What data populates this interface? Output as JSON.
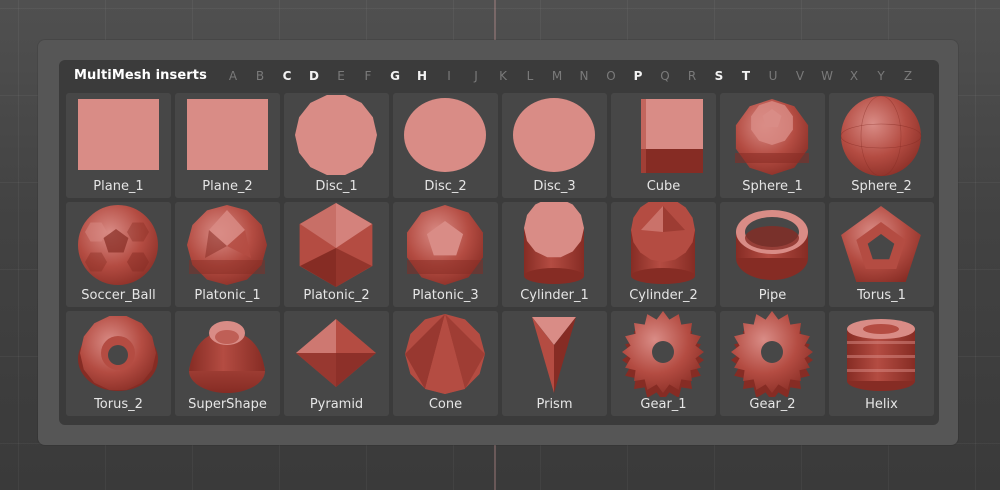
{
  "panel": {
    "title": "MultiMesh inserts",
    "letters": [
      {
        "char": "A",
        "active": false
      },
      {
        "char": "B",
        "active": false
      },
      {
        "char": "C",
        "active": true
      },
      {
        "char": "D",
        "active": true
      },
      {
        "char": "E",
        "active": false
      },
      {
        "char": "F",
        "active": false
      },
      {
        "char": "G",
        "active": true
      },
      {
        "char": "H",
        "active": true
      },
      {
        "char": "I",
        "active": false
      },
      {
        "char": "J",
        "active": false
      },
      {
        "char": "K",
        "active": false
      },
      {
        "char": "L",
        "active": false
      },
      {
        "char": "M",
        "active": false
      },
      {
        "char": "N",
        "active": false
      },
      {
        "char": "O",
        "active": false
      },
      {
        "char": "P",
        "active": true
      },
      {
        "char": "Q",
        "active": false
      },
      {
        "char": "R",
        "active": false
      },
      {
        "char": "S",
        "active": true
      },
      {
        "char": "T",
        "active": true
      },
      {
        "char": "U",
        "active": false
      },
      {
        "char": "V",
        "active": false
      },
      {
        "char": "W",
        "active": false
      },
      {
        "char": "X",
        "active": false
      },
      {
        "char": "Y",
        "active": false
      },
      {
        "char": "Z",
        "active": false
      }
    ]
  },
  "colors": {
    "background": "#474747",
    "panel": "#565656",
    "inner": "#3b3b3b",
    "tile": "#474747",
    "mesh_light": "#d98c86",
    "mesh_mid": "#b44c42",
    "mesh_dark": "#862c24"
  },
  "inserts": [
    {
      "label": "Plane_1",
      "icon": "plane-icon"
    },
    {
      "label": "Plane_2",
      "icon": "plane-icon"
    },
    {
      "label": "Disc_1",
      "icon": "disc-polygon-icon"
    },
    {
      "label": "Disc_2",
      "icon": "disc-icon"
    },
    {
      "label": "Disc_3",
      "icon": "disc-icon"
    },
    {
      "label": "Cube",
      "icon": "cube-icon"
    },
    {
      "label": "Sphere_1",
      "icon": "low-poly-sphere-icon"
    },
    {
      "label": "Sphere_2",
      "icon": "sphere-icon"
    },
    {
      "label": "Soccer_Ball",
      "icon": "soccer-ball-icon"
    },
    {
      "label": "Platonic_1",
      "icon": "platonic-icon"
    },
    {
      "label": "Platonic_2",
      "icon": "icosahedron-icon"
    },
    {
      "label": "Platonic_3",
      "icon": "dodecahedron-icon"
    },
    {
      "label": "Cylinder_1",
      "icon": "cylinder-icon"
    },
    {
      "label": "Cylinder_2",
      "icon": "faceted-cylinder-icon"
    },
    {
      "label": "Pipe",
      "icon": "pipe-icon"
    },
    {
      "label": "Torus_1",
      "icon": "pentagon-torus-icon"
    },
    {
      "label": "Torus_2",
      "icon": "torus-icon"
    },
    {
      "label": "SuperShape",
      "icon": "supershape-icon"
    },
    {
      "label": "Pyramid",
      "icon": "pyramid-icon"
    },
    {
      "label": "Cone",
      "icon": "cone-icon"
    },
    {
      "label": "Prism",
      "icon": "prism-icon"
    },
    {
      "label": "Gear_1",
      "icon": "gear-icon"
    },
    {
      "label": "Gear_2",
      "icon": "gear-icon"
    },
    {
      "label": "Helix",
      "icon": "helix-icon"
    }
  ]
}
